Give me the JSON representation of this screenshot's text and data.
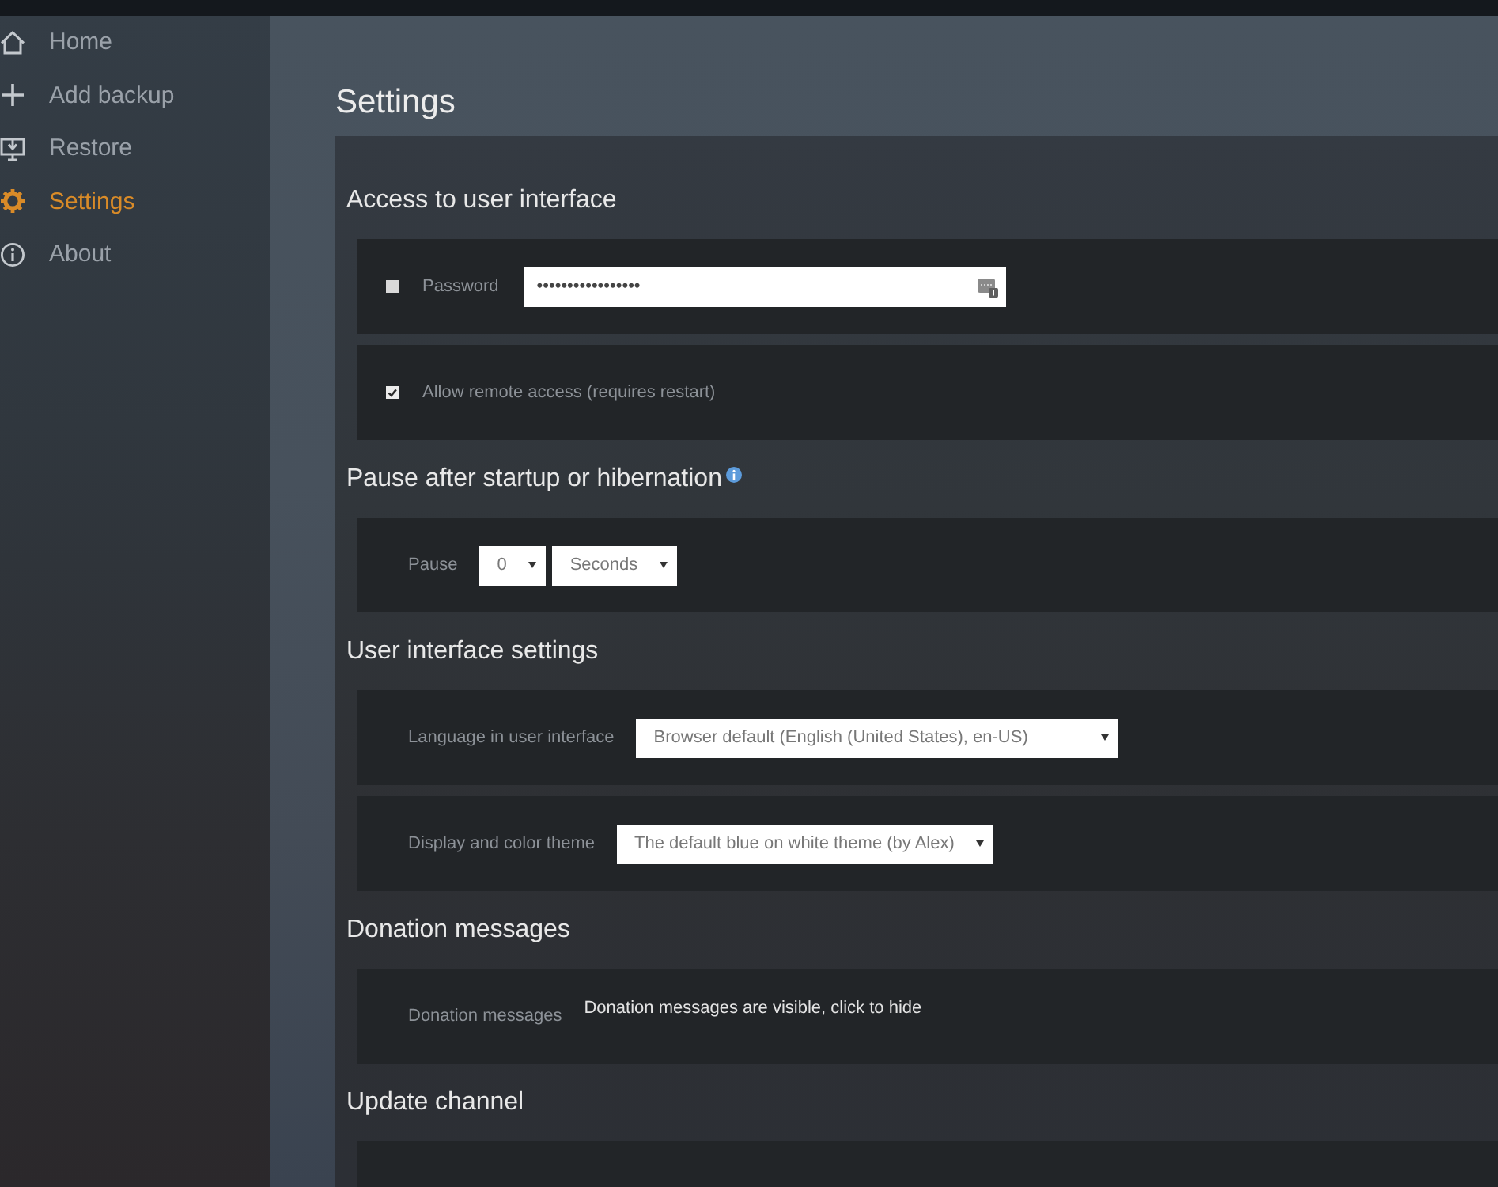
{
  "sidebar": {
    "items": [
      {
        "label": "Home",
        "selected": false
      },
      {
        "label": "Add backup",
        "selected": false
      },
      {
        "label": "Restore",
        "selected": false
      },
      {
        "label": "Settings",
        "selected": true
      },
      {
        "label": "About",
        "selected": false
      }
    ]
  },
  "page": {
    "title": "Settings"
  },
  "sections": [
    {
      "title": "Access to user interface",
      "rows": [
        {
          "kind": "password",
          "checked": false,
          "label": "Password",
          "value": "•••••••••••••••••"
        },
        {
          "kind": "checkbox",
          "checked": true,
          "label": "Allow remote access (requires restart)"
        }
      ]
    },
    {
      "title": "Pause after startup or hibernation",
      "info": true,
      "rows": [
        {
          "kind": "select",
          "label": "Pause",
          "selects": [
            {
              "value": "0"
            },
            {
              "value": "Seconds"
            }
          ]
        }
      ]
    },
    {
      "title": "User interface settings",
      "rows": [
        {
          "kind": "select",
          "label": "Language in user interface",
          "selects": [
            {
              "value": "Browser default (English (United States), en-US)"
            }
          ]
        },
        {
          "kind": "select",
          "label": "Display and color theme",
          "selects": [
            {
              "value": "The default blue on white theme (by Alex)"
            }
          ]
        }
      ]
    },
    {
      "title": "Donation messages",
      "rows": [
        {
          "kind": "link",
          "label": "Donation messages",
          "text": "Donation messages are visible, click to hide"
        }
      ]
    },
    {
      "title": "Update channel"
    }
  ]
}
